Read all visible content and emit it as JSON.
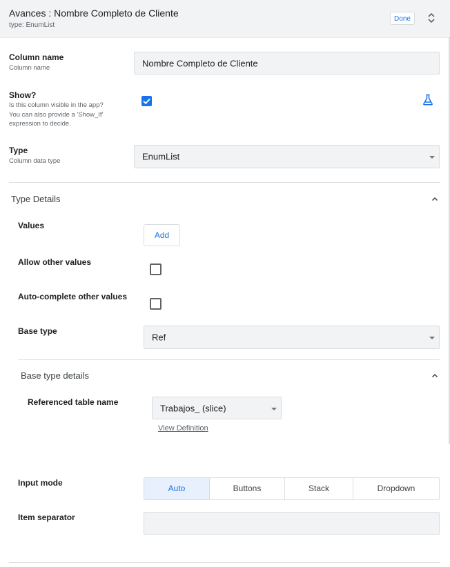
{
  "header": {
    "title": "Avances : Nombre Completo de Cliente",
    "type_line": "type: EnumList",
    "done_label": "Done",
    "sort_icon": "unfold-icon"
  },
  "column_name": {
    "label": "Column name",
    "sub": "Column name",
    "value": "Nombre Completo de Cliente"
  },
  "show": {
    "label": "Show?",
    "sub1": "Is this column visible in the app?",
    "sub2": "You can also provide a 'Show_If'",
    "sub3": "expression to decide.",
    "checked": true,
    "expression_icon": "flask-icon"
  },
  "type": {
    "label": "Type",
    "sub": "Column data type",
    "value": "EnumList"
  },
  "type_details": {
    "title": "Type Details",
    "values_label": "Values",
    "add_label": "Add",
    "allow_other_label": "Allow other values",
    "allow_other_checked": false,
    "autocomplete_label": "Auto-complete other values",
    "autocomplete_checked": false,
    "base_type_label": "Base type",
    "base_type_value": "Ref"
  },
  "base_type_details": {
    "title": "Base type details",
    "ref_table_label": "Referenced table name",
    "ref_table_value": "Trabajos_ (slice)",
    "view_definition": "View Definition"
  },
  "input_mode": {
    "label": "Input mode",
    "options": [
      "Auto",
      "Buttons",
      "Stack",
      "Dropdown"
    ],
    "selected": "Auto"
  },
  "item_separator": {
    "label": "Item separator",
    "value": ""
  },
  "colors": {
    "accent": "#1a73e8",
    "header_bg": "#f1f3f4",
    "field_bg": "#f1f3f4"
  }
}
